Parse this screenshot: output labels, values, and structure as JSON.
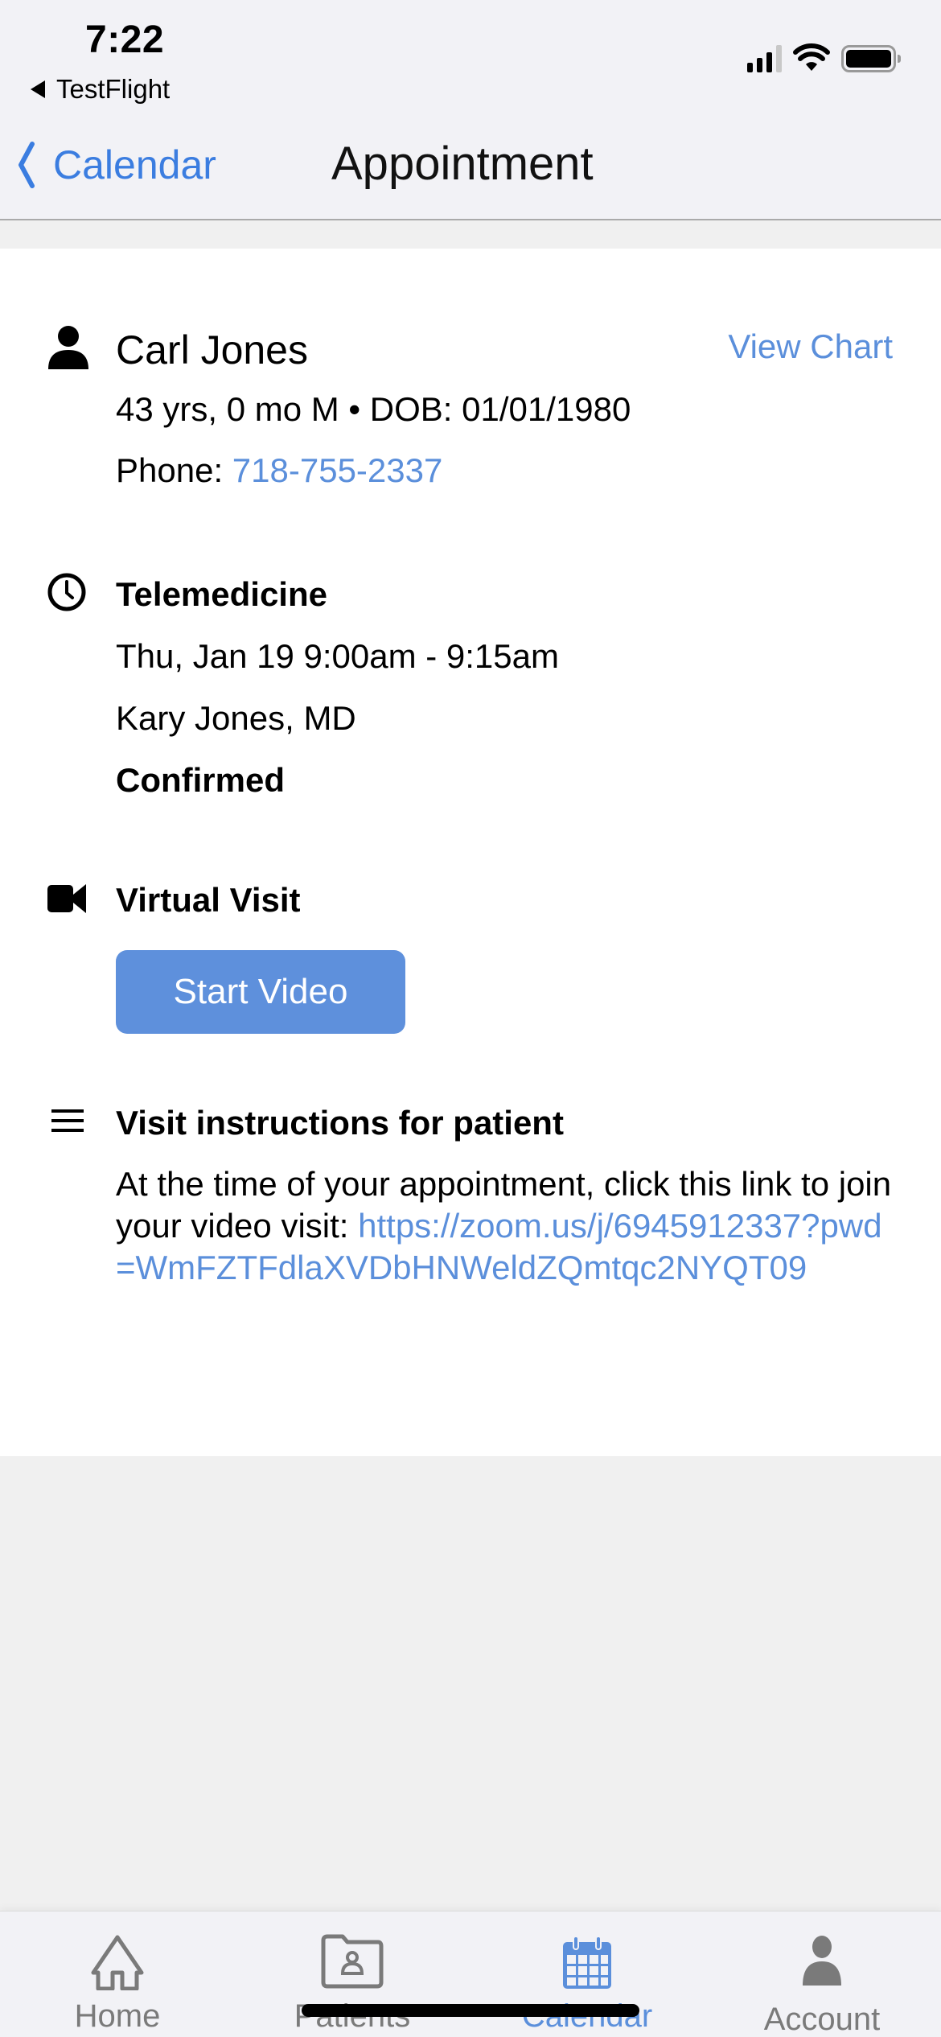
{
  "status_bar": {
    "time": "7:22",
    "back_app": "TestFlight",
    "icons": [
      "cellular-signal-icon",
      "wifi-icon",
      "battery-icon"
    ]
  },
  "nav": {
    "back_label": "Calendar",
    "title": "Appointment"
  },
  "patient": {
    "icon": "person-icon",
    "name": "Carl Jones",
    "view_chart_label": "View Chart",
    "demographics": "43 yrs, 0 mo M • DOB: 01/01/1980",
    "phone_label": "Phone: ",
    "phone": "718-755-2337"
  },
  "appointment": {
    "icon": "clock-icon",
    "type": "Telemedicine",
    "datetime": "Thu, Jan 19 9:00am - 9:15am",
    "provider": "Kary Jones, MD",
    "status": "Confirmed"
  },
  "virtual_visit": {
    "icon": "video-camera-icon",
    "title": "Virtual Visit",
    "button_label": "Start Video"
  },
  "instructions": {
    "icon": "menu-lines-icon",
    "title": "Visit instructions for patient",
    "text": "At the time of your appointment, click this link to join your video visit: ",
    "link": "https://zoom.us/j/6945912337?pwd=WmFZTFdlaXVDbHNWeldZQmtqc2NYQT09"
  },
  "colors": {
    "accent": "#5b8fdb",
    "nav_accent": "#3b7de0",
    "button": "#5e90dc",
    "inactive_tab": "#7a7a7a"
  },
  "tabs": [
    {
      "label": "Home",
      "icon": "home-icon",
      "active": false
    },
    {
      "label": "Patients",
      "icon": "patient-folder-icon",
      "active": false
    },
    {
      "label": "Calendar",
      "icon": "calendar-icon",
      "active": true
    },
    {
      "label": "Account",
      "icon": "account-icon",
      "active": false
    }
  ]
}
